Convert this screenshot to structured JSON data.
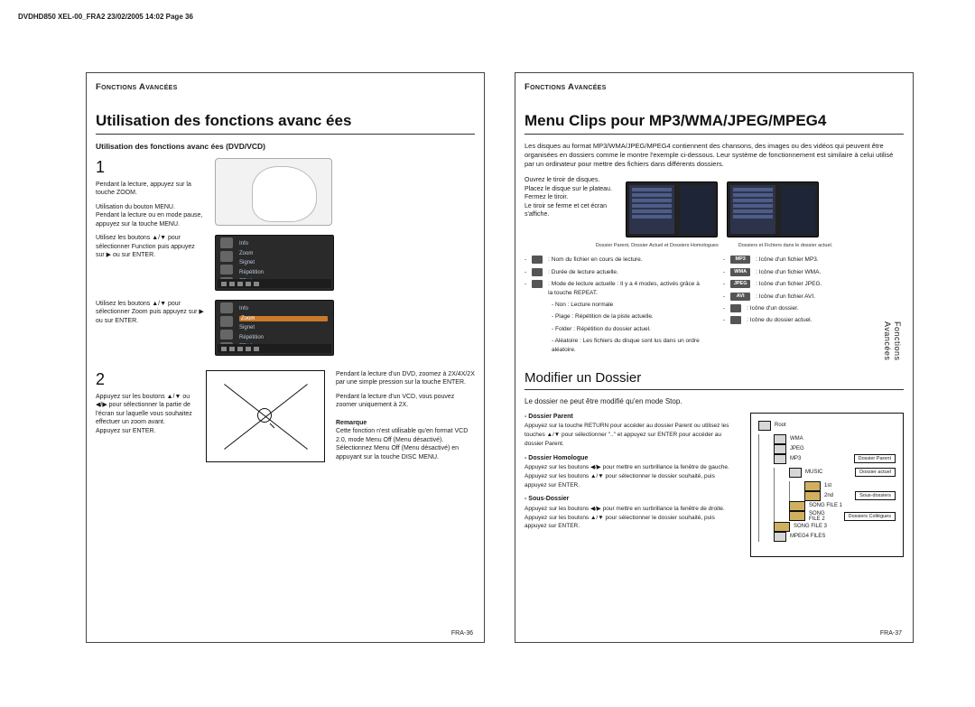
{
  "slug": "DVDHD850 XEL-00_FRA2  23/02/2005  14:02  Page 36",
  "section_header": "Fonctions Avancées",
  "side_tab_line1": "Fonctions",
  "side_tab_line2": "Avancées",
  "left": {
    "title": "Utilisation des fonctions avanc     ées",
    "sub": "Utilisation des fonctions avanc     ées (DVD/VCD)",
    "step1no": "1",
    "step2no": "2",
    "s1_p1": "Pendant la lecture, appuyez sur la touche ZOOM.",
    "s1_p2": "Utilisation du bouton MENU.",
    "s1_p3": "Pendant la lecture ou en mode pause, appuyez sur la touche MENU.",
    "s1_p4": "Utilisez les boutons ▲/▼ pour sélectionner Function puis appuyez sur ▶ ou sur ENTER.",
    "s1_p5": "Utilisez les boutons ▲/▼ pour sélectionner Zoom puis appuyez sur ▶ ou sur ENTER.",
    "menu_items": {
      "a": "Info",
      "b": "Zoom",
      "c": "Signet",
      "d": "Répétition",
      "e": "EZ View"
    },
    "s2_p1": "Appuyez sur les boutons ▲/▼ ou ◀/▶ pour sélectionner la partie de l'écran sur laquelle vous souhaitez effectuer un zoom avant.",
    "s2_p2": "Appuyez sur ENTER.",
    "right_col": {
      "t1": "Pendant la lecture d'un DVD, zoomez à 2X/4X/2X par une simple pression sur la touche ENTER.",
      "t2": "Pendant la lecture d'un VCD, vous pouvez zoomer uniquement à 2X.",
      "rem_h": "Remarque",
      "rem_1": "Cette fonction n'est utilisable qu'en format VCD 2.0, mode Menu Off (Menu désactivé).",
      "rem_2": "Sélectionnez Menu Off (Menu désactivé) en appuyant sur la touche DISC MENU."
    },
    "page_no": "FRA-36"
  },
  "right": {
    "title": "Menu Clips pour MP3/WMA/JPEG/MPEG4",
    "intro": "Les disques au format MP3/WMA/JPEG/MPEG4 contiennent des chansons, des images ou des vidéos qui peuvent être organisées en dossiers comme le montre l'exemple ci-dessous. Leur système de fonctionnement est similaire à celui utilisé par un ordinateur pour mettre des fichiers dans différents dossiers.",
    "steps": {
      "l1": "Ouvrez le tiroir de disques.",
      "l2": "Placez le disque sur le plateau.",
      "l3": "Fermez le tiroir.",
      "l4": "Le tiroir se ferme et cet écran s'affiche."
    },
    "caption_l": "Dossier Parent, Dossier Actuel et Dossiers Homologues",
    "caption_r": "Dossiers et Fichiers dans le dossier actuel.",
    "legend_left": [
      ": Nom du fichier en cours de lecture.",
      ": Durée de lecture actuelle.",
      ": Mode de lecture actuelle : Il y a 4 modes, activés grâce à la touche REPEAT.",
      "- Non : Lecture normale",
      "- Plage : Répétition de la piste actuelle.",
      "- Folder : Répétition du dossier actuel.",
      "- Aléatoire : Les fichiers du disque sont lus dans un ordre aléatoire."
    ],
    "legend_right": [
      {
        "ico": "MP3",
        "t": ": Icône d'un fichier MP3."
      },
      {
        "ico": "WMA",
        "t": ": Icône d'un fichier WMA."
      },
      {
        "ico": "JPEG",
        "t": ": Icône d'un fichier JPEG."
      },
      {
        "ico": "AVI",
        "t": ": Icône d'un fichier AVI."
      },
      {
        "ico": "",
        "t": ": Icône d'un dossier."
      },
      {
        "ico": "",
        "t": ": Icône du dossier actuel."
      }
    ],
    "h2": "Modifier un Dossier",
    "sub2": "Le dossier ne peut être modifié qu'en mode Stop.",
    "bullets": [
      {
        "h": "Dossier Parent",
        "t": "Appuyez sur la touche RETURN pour accéder au dossier Parent ou utilisez les touches ▲/▼ pour sélectionner \"..\" et appuyez sur ENTER pour accéder au dossier Parent."
      },
      {
        "h": "Dossier Homologue",
        "t": "Appuyez sur les boutons ◀/▶ pour mettre en surbrillance la fenêtre de gauche. Appuyez sur les boutons ▲/▼ pour sélectionner le dossier souhaité, puis appuyez sur ENTER."
      },
      {
        "h": "Sous-Dossier",
        "t": "Appuyez sur les boutons ◀/▶ pour mettre en surbrillance la fenêtre de droite. Appuyez sur les boutons ▲/▼ pour sélectionner le dossier souhaité, puis appuyez sur ENTER."
      }
    ],
    "tree": {
      "root": "Root",
      "n1": "WMA",
      "n2": "JPEG",
      "n3": "MP3",
      "tag3": "Dossier Parent",
      "n4": "MUSIC",
      "tag4": "Dossier actuel",
      "n5": "1st",
      "n6": "2nd",
      "tag56": "Sous-dossiers",
      "n7": "SONG FILE 1",
      "n8": "SONG FILE 2",
      "tag78": "Dossiers Collègues",
      "n9": "SONG FILE 3",
      "n10": "MPEG4 FILES"
    },
    "page_no": "FRA-37"
  }
}
